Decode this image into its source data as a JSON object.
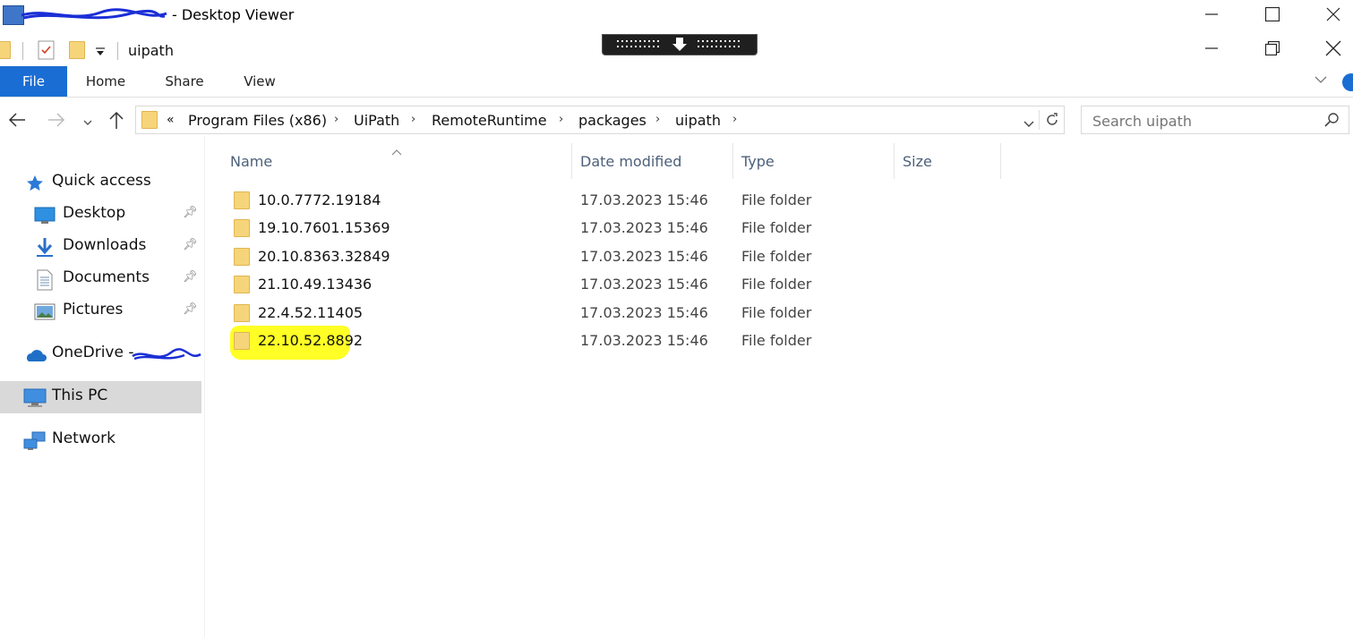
{
  "viewer": {
    "title": "- Desktop Viewer"
  },
  "explorer": {
    "qat_title": "uipath",
    "ribbon_tabs": [
      "File",
      "Home",
      "Share",
      "View"
    ],
    "address": {
      "overflow": "«",
      "crumbs": [
        "Program Files (x86)",
        "UiPath",
        "RemoteRuntime",
        "packages",
        "uipath"
      ]
    },
    "search": {
      "placeholder": "Search uipath"
    },
    "nav": {
      "quick_access": "Quick access",
      "desktop": "Desktop",
      "downloads": "Downloads",
      "documents": "Documents",
      "pictures": "Pictures",
      "onedrive": "OneDrive -",
      "this_pc": "This PC",
      "network": "Network"
    },
    "columns": {
      "name": "Name",
      "date": "Date modified",
      "type": "Type",
      "size": "Size"
    },
    "files": [
      {
        "name": "10.0.7772.19184",
        "date": "17.03.2023 15:46",
        "type": "File folder"
      },
      {
        "name": "19.10.7601.15369",
        "date": "17.03.2023 15:46",
        "type": "File folder"
      },
      {
        "name": "20.10.8363.32849",
        "date": "17.03.2023 15:46",
        "type": "File folder"
      },
      {
        "name": "21.10.49.13436",
        "date": "17.03.2023 15:46",
        "type": "File folder"
      },
      {
        "name": "22.4.52.11405",
        "date": "17.03.2023 15:46",
        "type": "File folder"
      },
      {
        "name": "22.10.52.8892",
        "date": "17.03.2023 15:46",
        "type": "File folder"
      }
    ]
  },
  "colors": {
    "accent": "#1a6dd3",
    "highlight": "#ffff1a",
    "selected_nav": "#d9d9d9"
  },
  "icons": [
    "app-icon",
    "minimize-icon",
    "maximize-icon",
    "close-icon",
    "restore-icon",
    "folder-icon",
    "properties-icon",
    "dropdown-icon",
    "back-arrow-icon",
    "forward-arrow-icon",
    "up-arrow-icon",
    "refresh-icon",
    "search-icon",
    "star-icon",
    "desktop-icon",
    "download-icon",
    "document-icon",
    "picture-icon",
    "cloud-icon",
    "computer-icon",
    "network-icon",
    "pin-icon",
    "help-icon"
  ]
}
